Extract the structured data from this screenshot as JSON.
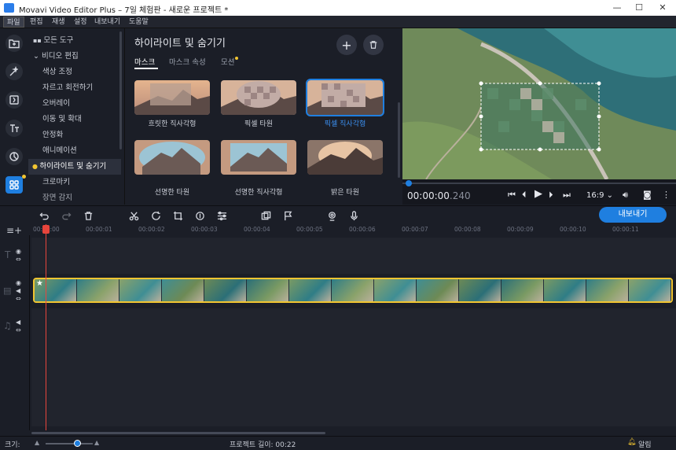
{
  "window": {
    "title": "Movavi Video Editor Plus – 7일 체험판 - 새로운 프로젝트 *",
    "minimize": "—",
    "maximize": "☐",
    "close": "✕"
  },
  "menu": [
    "파일",
    "편집",
    "재생",
    "설정",
    "내보내기",
    "도움말"
  ],
  "left_tools": [
    "import-icon",
    "magic-wand-icon",
    "transitions-icon",
    "titles-icon",
    "filters-icon",
    "more-tools-icon"
  ],
  "tool_list": {
    "all_tools": "모든 도구",
    "video_editing": "비디오 편집",
    "items": [
      "색상 조정",
      "자르고 회전하기",
      "오버레이",
      "이동 및 확대",
      "안정화",
      "애니메이션",
      "하이라이트 및 숨기기",
      "크로마키",
      "장면 감지"
    ],
    "selected_index": 6
  },
  "effects": {
    "title": "하이라이트 및 숨기기",
    "tabs": [
      "마스크",
      "마스크 속성",
      "모션"
    ],
    "active_tab": 0,
    "items": [
      {
        "label": "흐릿한 직사각형",
        "style": "blur-rect"
      },
      {
        "label": "픽셀 타원",
        "style": "pixel-oval"
      },
      {
        "label": "픽셀 직사각형",
        "style": "pixel-rect",
        "selected": true
      },
      {
        "label": "선명한 타원",
        "style": "sharp-oval"
      },
      {
        "label": "선명한 직사각형",
        "style": "sharp-rect"
      },
      {
        "label": "밝은 타원",
        "style": "bright-oval"
      }
    ]
  },
  "player": {
    "time_main": "00:00:00",
    "time_ms": ".240",
    "aspect": "16:9"
  },
  "timeline": {
    "export_label": "내보내기",
    "ruler": [
      "00:00:00",
      "00:00:01",
      "00:00:02",
      "00:00:03",
      "00:00:04",
      "00:00:05",
      "00:00:06",
      "00:00:07",
      "00:00:08",
      "00:00:09",
      "00:00:10",
      "00:00:11"
    ]
  },
  "status": {
    "scale_label": "크기:",
    "project_length": "프로젝트 길이: 00:22",
    "notifications": "알림"
  },
  "colors": {
    "accent": "#1f7fe0",
    "playhead": "#e8453c",
    "clip_border": "#f2c531"
  }
}
